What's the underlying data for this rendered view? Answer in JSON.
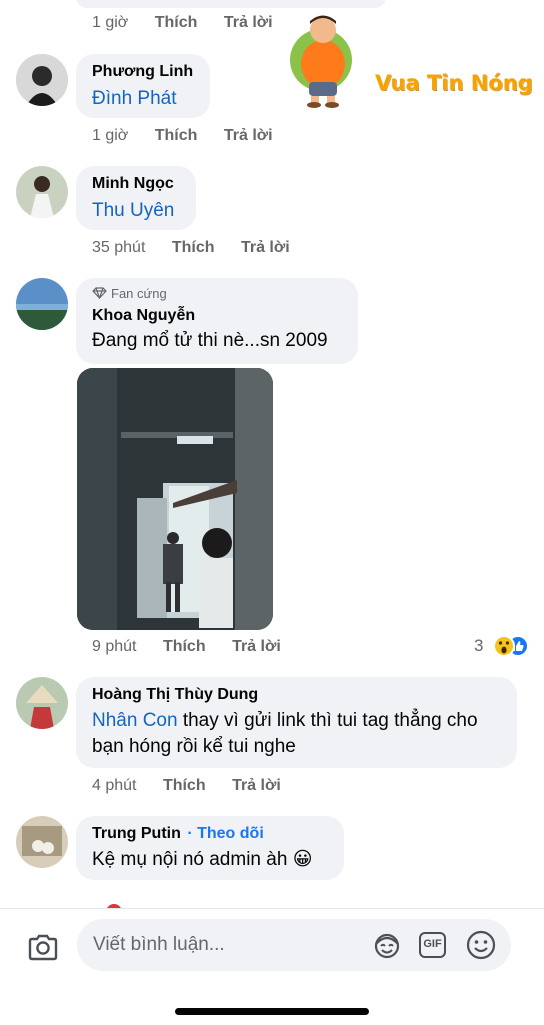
{
  "watermark": {
    "text": "Vua Tin Nóng"
  },
  "comments": [
    {
      "time": "1 giờ",
      "like": "Thích",
      "reply": "Trả lời"
    },
    {
      "author": "Phương Linh",
      "text": "Đình Phát",
      "time": "1 giờ",
      "like": "Thích",
      "reply": "Trả lời"
    },
    {
      "author": "Minh Ngọc",
      "text": "Thu Uyên",
      "time": "35 phút",
      "like": "Thích",
      "reply": "Trả lời"
    },
    {
      "badge": "Fan cứng",
      "author": "Khoa Nguyễn",
      "text": "Đang mổ tử thi nè...sn 2009",
      "time": "9 phút",
      "like": "Thích",
      "reply": "Trả lời",
      "reaction_count": "3"
    },
    {
      "author": "Hoàng Thị Thùy Dung",
      "tag": "Nhân Con",
      "text": " thay vì gửi link thì tui tag thẳng cho bạn hóng rồi kể tui nghe",
      "time": "4 phút",
      "like": "Thích",
      "reply": "Trả lời"
    },
    {
      "author": "Trung Putin",
      "follow": "· Theo dõi",
      "text": "Kệ mụ nội nó admin àh",
      "emoji": "😀"
    }
  ],
  "composer": {
    "placeholder": "Viết bình luận...",
    "gif": "GIF"
  },
  "colors": {
    "bubble": "#f0f2f5",
    "link": "#1565c0",
    "meta": "#65676b",
    "like_blue": "#1877f2"
  }
}
